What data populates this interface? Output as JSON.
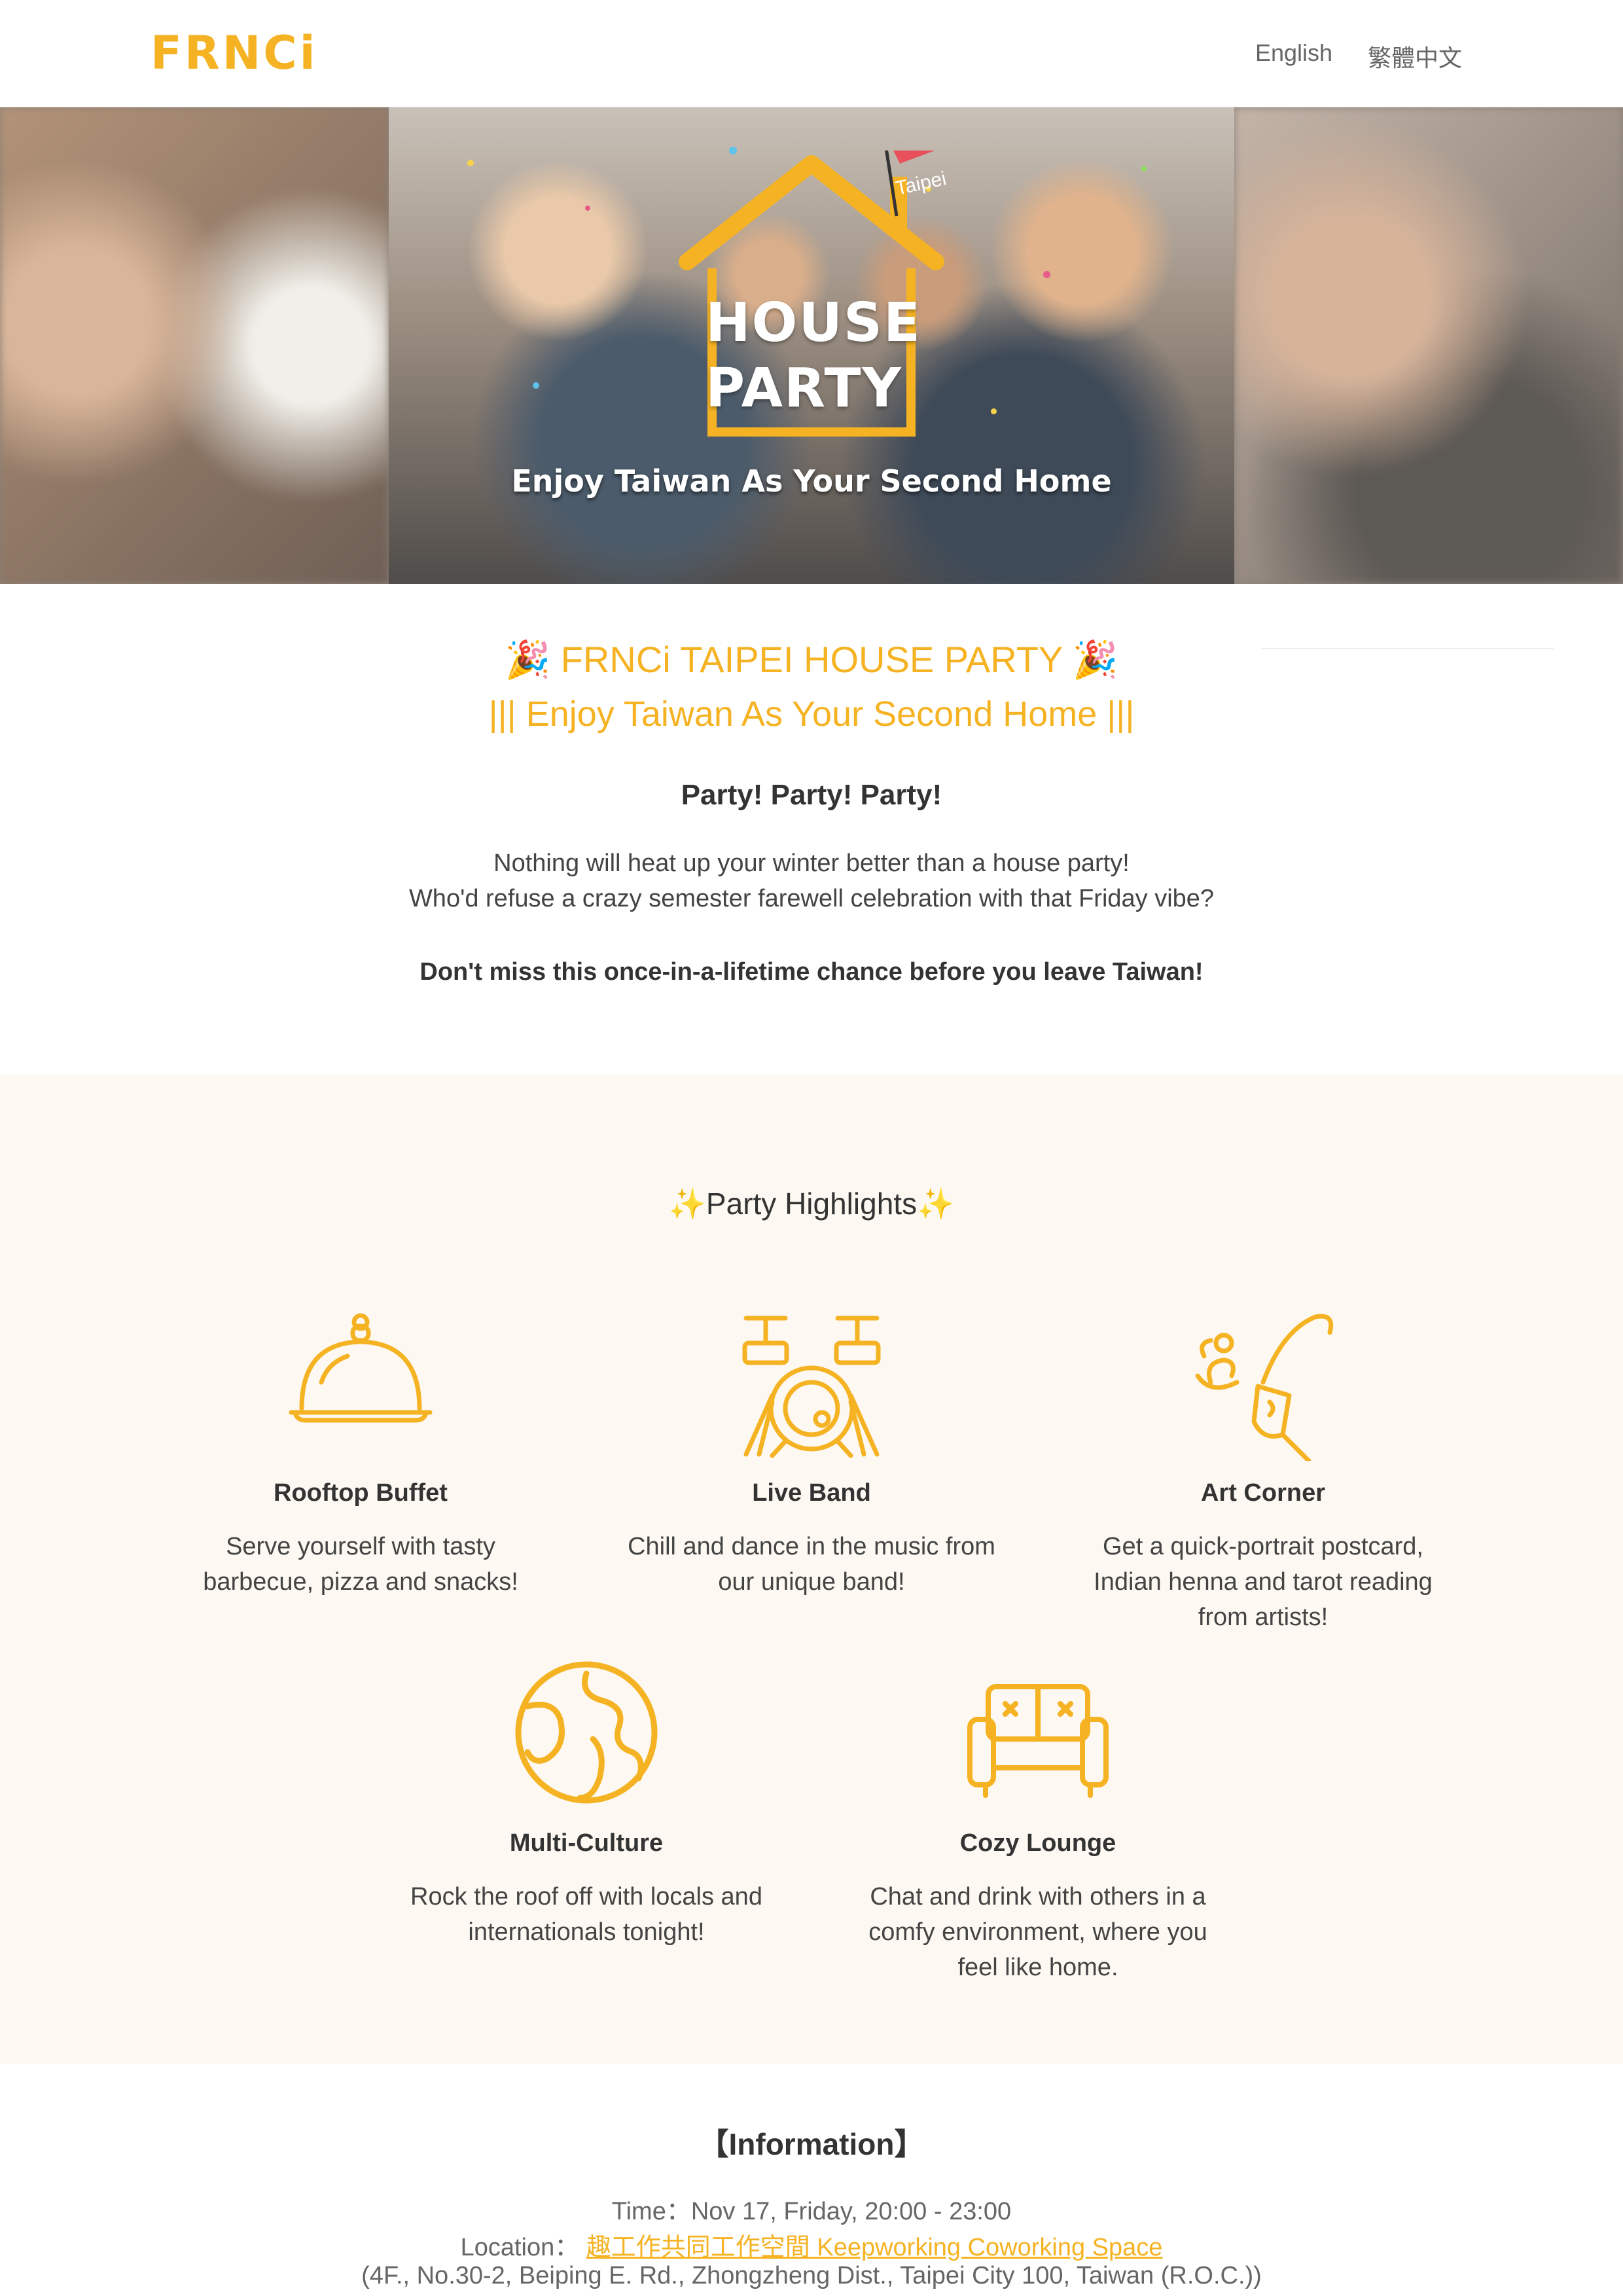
{
  "header": {
    "logo": "FRNCi",
    "lang_english": "English",
    "lang_chinese": "繁體中文"
  },
  "hero": {
    "flag": "Taipei",
    "title_line1": "HOUSE",
    "title_line2": "PARTY",
    "tagline": "Enjoy Taiwan As Your Second Home"
  },
  "intro": {
    "title": "🎉 FRNCi TAIPEI HOUSE PARTY 🎉",
    "subtitle": "||| Enjoy Taiwan As Your Second Home |||",
    "party_line": "Party!  Party!  Party!",
    "paragraph_line1": "Nothing will heat up your winter better than a house party!",
    "paragraph_line2": "Who'd refuse a crazy semester farewell celebration with that Friday vibe?",
    "emphasis": "Don't miss this once-in-a-lifetime chance before you leave Taiwan!"
  },
  "highlights": {
    "title": "✨Party Highlights✨",
    "items": [
      {
        "icon": "food-cloche-icon",
        "name": "Rooftop Buffet",
        "desc_line1": "Serve yourself with tasty",
        "desc_line2": "barbecue, pizza and snacks!",
        "desc_line3": ""
      },
      {
        "icon": "drum-kit-icon",
        "name": "Live Band",
        "desc_line1": "Chill and dance in the music from",
        "desc_line2": "our unique band!",
        "desc_line3": ""
      },
      {
        "icon": "henna-art-icon",
        "name": "Art Corner",
        "desc_line1": "Get a quick-portrait postcard,",
        "desc_line2": "Indian henna and tarot reading",
        "desc_line3": "from artists!"
      },
      {
        "icon": "globe-icon",
        "name": "Multi-Culture",
        "desc_line1": "Rock the roof off with locals and",
        "desc_line2": "internationals tonight!",
        "desc_line3": ""
      },
      {
        "icon": "sofa-icon",
        "name": "Cozy Lounge",
        "desc_line1": "Chat and drink with others in a",
        "desc_line2": "comfy environment, where you",
        "desc_line3": "feel like home."
      }
    ]
  },
  "info": {
    "title": "【Information】",
    "time": "Time：Nov 17, Friday, 20:00 - 23:00",
    "location_label": "Location：",
    "location_link": "趣工作共同工作空間 Keepworking Coworking Space",
    "address": "(4F., No.30-2, Beiping E. Rd., Zhongzheng Dist., Taipei City 100, Taiwan (R.O.C.))"
  },
  "colors": {
    "accent": "#f5b324",
    "highlight_bg": "#fdf9f2",
    "text": "#333333"
  }
}
